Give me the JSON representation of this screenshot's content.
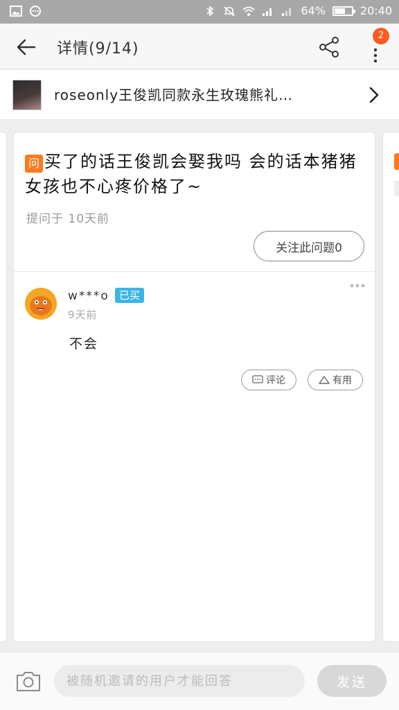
{
  "status_bar": {
    "battery_text": "64%",
    "battery_level": 0.64,
    "time": "20:40",
    "left_icons": [
      "gallery-icon",
      "message-icon"
    ],
    "right_icons": [
      "bluetooth-icon",
      "mute-icon",
      "wifi-icon",
      "signal-icon",
      "signal-icon-2",
      "battery-icon"
    ]
  },
  "header": {
    "title": "详情(9/14)",
    "badge_count": "2"
  },
  "product": {
    "title": "roseonly王俊凯同款永生玫瑰熊礼…"
  },
  "question": {
    "tag": "问",
    "text": "买了的话王俊凯会娶我吗 会的话本猪猪女孩也不心疼价格了~",
    "meta": "提问于 10天前",
    "follow_label": "关注此问题0"
  },
  "answer": {
    "user_name": "w***o",
    "bought_badge": "已买",
    "time": "9天前",
    "text": "不会",
    "comment_label": "评论",
    "useful_label": "有用"
  },
  "bottom_bar": {
    "input_placeholder": "被随机邀请的用户才能回答",
    "send_label": "发送"
  },
  "colors": {
    "accent_orange": "#ff7a1f",
    "badge_orange": "#ff5a1f",
    "bought_blue": "#3cb4e8",
    "status_bar": "#a8a8a8"
  }
}
